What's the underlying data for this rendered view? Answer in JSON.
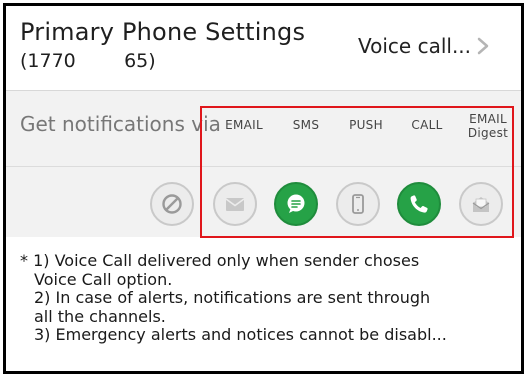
{
  "header": {
    "title": "Primary Phone Settings",
    "phone_number": "(1770        65)",
    "voice_call_link": "Voice call..."
  },
  "notifications": {
    "label": "Get notifications via",
    "channels": [
      {
        "label": "EMAIL",
        "icon": "email-icon",
        "enabled": false
      },
      {
        "label": "SMS",
        "icon": "chat-bubble-icon",
        "enabled": true
      },
      {
        "label": "PUSH",
        "icon": "mobile-phone-icon",
        "enabled": false
      },
      {
        "label": "CALL",
        "icon": "phone-handset-icon",
        "enabled": true
      },
      {
        "label": "EMAIL",
        "label2": "Digest",
        "icon": "email-digest-icon",
        "enabled": false
      }
    ],
    "disable_all_icon": "no-symbol-icon"
  },
  "notes": [
    "* 1) Voice Call delivered only when sender choses",
    "Voice Call option.",
    "2) In case of alerts, notifications are sent through",
    "all the channels.",
    "3) Emergency alerts and notices cannot be disabl..."
  ],
  "colors": {
    "enabled": "#26a247",
    "disabled": "#ececec",
    "highlight_box": "#e0161b",
    "band": "#f2f2f2"
  }
}
